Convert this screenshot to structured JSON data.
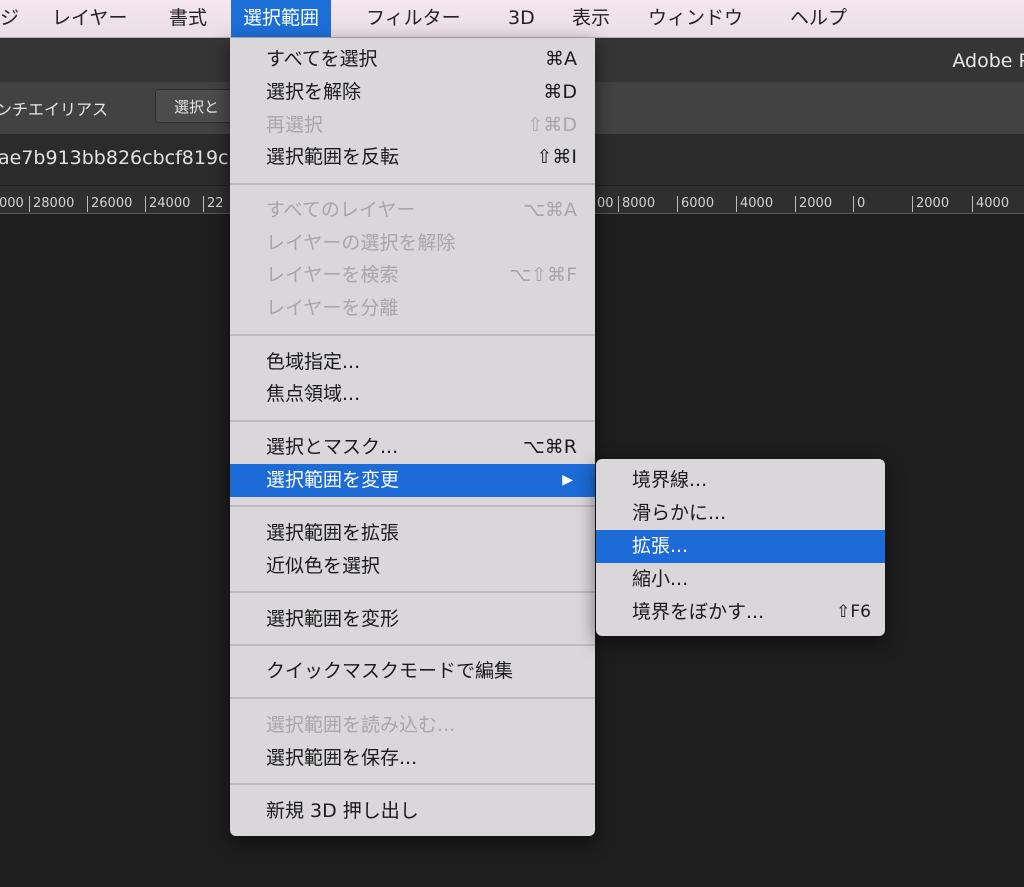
{
  "menubar": {
    "items": [
      "ジ",
      "レイヤー",
      "書式",
      "選択範囲",
      "フィルター",
      "3D",
      "表示",
      "ウィンドウ",
      "ヘルプ"
    ]
  },
  "app": {
    "title": "Adobe P"
  },
  "options_bar": {
    "antialias_label": "ンチエイリアス",
    "select_mask_button": "選択と"
  },
  "document_tab": {
    "title": "ae7b913bb826cbcf819c"
  },
  "ruler": {
    "ticks": [
      "000",
      "28000",
      "26000",
      "24000",
      "22",
      "00",
      "8000",
      "6000",
      "4000",
      "2000",
      "0",
      "2000",
      "4000"
    ]
  },
  "menu": {
    "items": [
      {
        "label": "すべてを選択",
        "shortcut": "⌘A",
        "enabled": true
      },
      {
        "label": "選択を解除",
        "shortcut": "⌘D",
        "enabled": true
      },
      {
        "label": "再選択",
        "shortcut": "⇧⌘D",
        "enabled": false
      },
      {
        "label": "選択範囲を反転",
        "shortcut": "⇧⌘I",
        "enabled": true
      },
      {
        "label": "すべてのレイヤー",
        "shortcut": "⌥⌘A",
        "enabled": false
      },
      {
        "label": "レイヤーの選択を解除",
        "shortcut": "",
        "enabled": false
      },
      {
        "label": "レイヤーを検索",
        "shortcut": "⌥⇧⌘F",
        "enabled": false
      },
      {
        "label": "レイヤーを分離",
        "shortcut": "",
        "enabled": false
      },
      {
        "label": "色域指定...",
        "shortcut": "",
        "enabled": true
      },
      {
        "label": "焦点領域...",
        "shortcut": "",
        "enabled": true
      },
      {
        "label": "選択とマスク...",
        "shortcut": "⌥⌘R",
        "enabled": true
      },
      {
        "label": "選択範囲を変更",
        "shortcut": "",
        "enabled": true,
        "submenu_arrow": "▶"
      },
      {
        "label": "選択範囲を拡張",
        "shortcut": "",
        "enabled": true
      },
      {
        "label": "近似色を選択",
        "shortcut": "",
        "enabled": true
      },
      {
        "label": "選択範囲を変形",
        "shortcut": "",
        "enabled": true
      },
      {
        "label": "クイックマスクモードで編集",
        "shortcut": "",
        "enabled": true
      },
      {
        "label": "選択範囲を読み込む...",
        "shortcut": "",
        "enabled": false
      },
      {
        "label": "選択範囲を保存...",
        "shortcut": "",
        "enabled": true
      },
      {
        "label": "新規 3D 押し出し",
        "shortcut": "",
        "enabled": true
      }
    ],
    "highlighted": "選択範囲を変更"
  },
  "submenu": {
    "items": [
      {
        "label": "境界線...",
        "shortcut": ""
      },
      {
        "label": "滑らかに...",
        "shortcut": ""
      },
      {
        "label": "拡張...",
        "shortcut": ""
      },
      {
        "label": "縮小...",
        "shortcut": ""
      },
      {
        "label": "境界をぼかす...",
        "shortcut": "⇧F6"
      }
    ],
    "highlighted": "拡張..."
  },
  "colors": {
    "accent": "#1c6bd6",
    "menu_bg": "#d9d7da",
    "canvas_bg": "#1e1e1e",
    "menubar_bg": "#efe3ea"
  }
}
